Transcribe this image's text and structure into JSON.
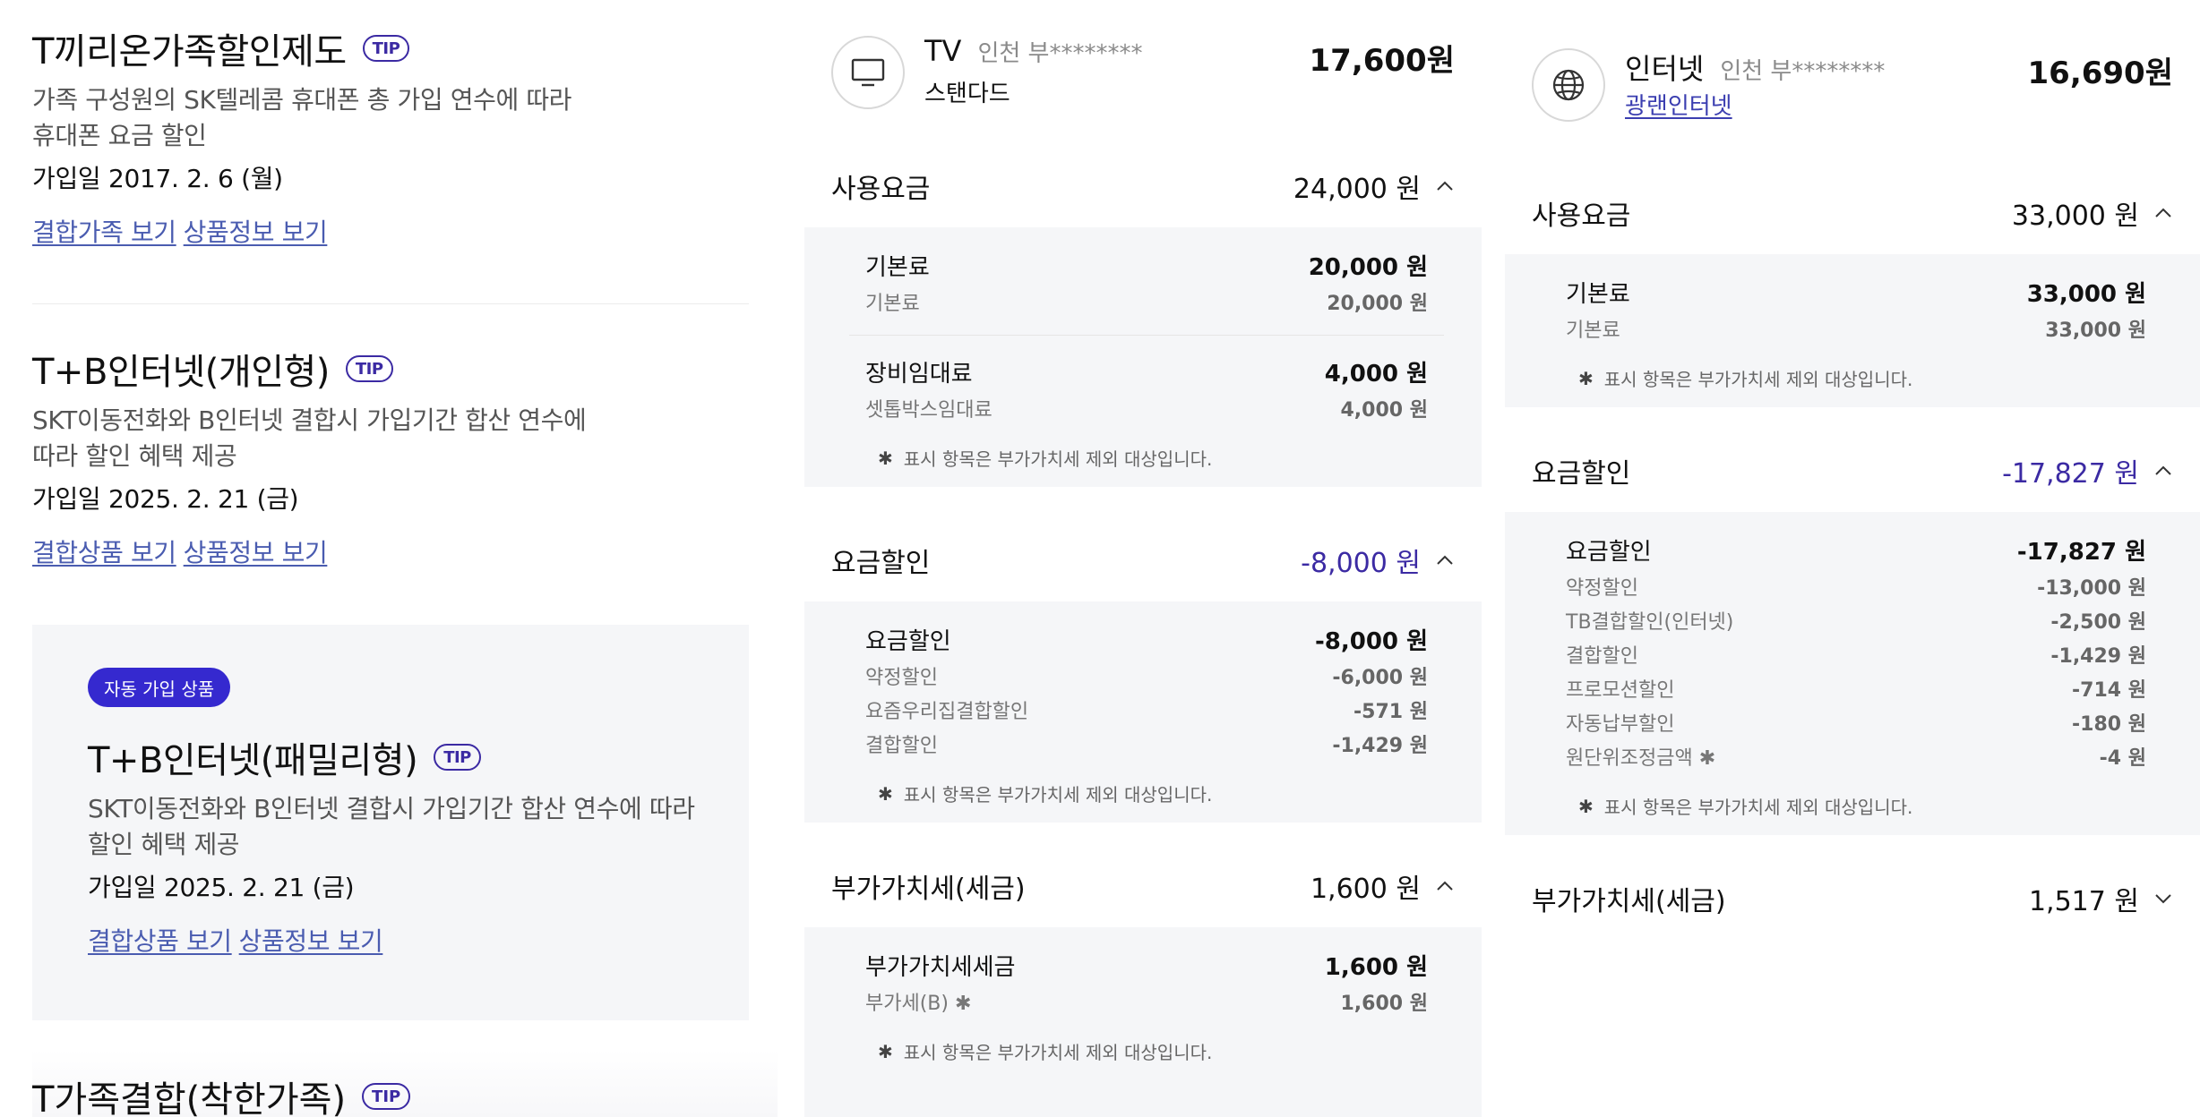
{
  "left": {
    "discounts": [
      {
        "title": "T끼리온가족할인제도",
        "tip": "TIP",
        "desc": "가족 구성원의 SK텔레콤 휴대폰 총 가입 연수에 따라\n휴대폰 요금 할인",
        "date": "가입일 2017. 2. 6 (월)",
        "link1": "결합가족 보기",
        "link2": "상품정보 보기"
      },
      {
        "title": "T+B인터넷(개인형)",
        "tip": "TIP",
        "desc": "SKT이동전화와 B인터넷 결합시 가입기간 합산 연수에\n따라 할인 혜택 제공",
        "date": "가입일 2025. 2. 21 (금)",
        "link1": "결합상품 보기",
        "link2": "상품정보 보기"
      },
      {
        "badge": "자동 가입 상품",
        "title": "T+B인터넷(패밀리형)",
        "tip": "TIP",
        "desc": "SKT이동전화와 B인터넷 결합시 가입기간 합산 연수에 따라\n할인 혜택 제공",
        "date": "가입일 2025. 2. 21 (금)",
        "link1": "결합상품 보기",
        "link2": "상품정보 보기"
      }
    ],
    "cutoff_title": "T가족결합(착한가족)",
    "cutoff_tip": "TIP"
  },
  "tv": {
    "icon": "tv-icon",
    "name": "TV",
    "location": "인천 부********",
    "plan": "스탠다드",
    "price": "17,600원",
    "usage": {
      "label": "사용요금",
      "value": "24,000 원",
      "groups": [
        {
          "name": "기본료",
          "value": "20,000 원",
          "items": [
            {
              "name": "기본료",
              "value": "20,000 원"
            }
          ]
        },
        {
          "name": "장비임대료",
          "value": "4,000 원",
          "items": [
            {
              "name": "셋톱박스임대료",
              "value": "4,000 원"
            }
          ]
        }
      ],
      "note": "표시 항목은 부가가치세 제외 대상입니다."
    },
    "discount": {
      "label": "요금할인",
      "value": "-8,000 원",
      "main": {
        "name": "요금할인",
        "value": "-8,000 원"
      },
      "items": [
        {
          "name": "약정할인",
          "value": "-6,000 원"
        },
        {
          "name": "요즘우리집결합할인",
          "value": "-571 원"
        },
        {
          "name": "결합할인",
          "value": "-1,429 원"
        }
      ],
      "note": "표시 항목은 부가가치세 제외 대상입니다."
    },
    "vat": {
      "label": "부가가치세(세금)",
      "value": "1,600 원",
      "main": {
        "name": "부가가치세세금",
        "value": "1,600 원"
      },
      "items": [
        {
          "name": "부가세(B)",
          "value": "1,600 원"
        }
      ],
      "note": "표시 항목은 부가가치세 제외 대상입니다."
    }
  },
  "internet": {
    "icon": "globe-icon",
    "name": "인터넷",
    "location": "인천 부********",
    "plan": "광랜인터넷",
    "price": "16,690원",
    "usage": {
      "label": "사용요금",
      "value": "33,000 원",
      "main": {
        "name": "기본료",
        "value": "33,000 원"
      },
      "items": [
        {
          "name": "기본료",
          "value": "33,000 원"
        }
      ],
      "note": "표시 항목은 부가가치세 제외 대상입니다."
    },
    "discount": {
      "label": "요금할인",
      "value": "-17,827 원",
      "main": {
        "name": "요금할인",
        "value": "-17,827 원"
      },
      "items": [
        {
          "name": "약정할인",
          "value": "-13,000 원"
        },
        {
          "name": "TB결합할인(인터넷)",
          "value": "-2,500 원"
        },
        {
          "name": "결합할인",
          "value": "-1,429 원"
        },
        {
          "name": "프로모션할인",
          "value": "-714 원"
        },
        {
          "name": "자동납부할인",
          "value": "-180 원"
        },
        {
          "name": "원단위조정금액",
          "value": "-4 원"
        }
      ],
      "note": "표시 항목은 부가가치세 제외 대상입니다."
    },
    "vat": {
      "label": "부가가치세(세금)",
      "value": "1,517 원"
    }
  }
}
